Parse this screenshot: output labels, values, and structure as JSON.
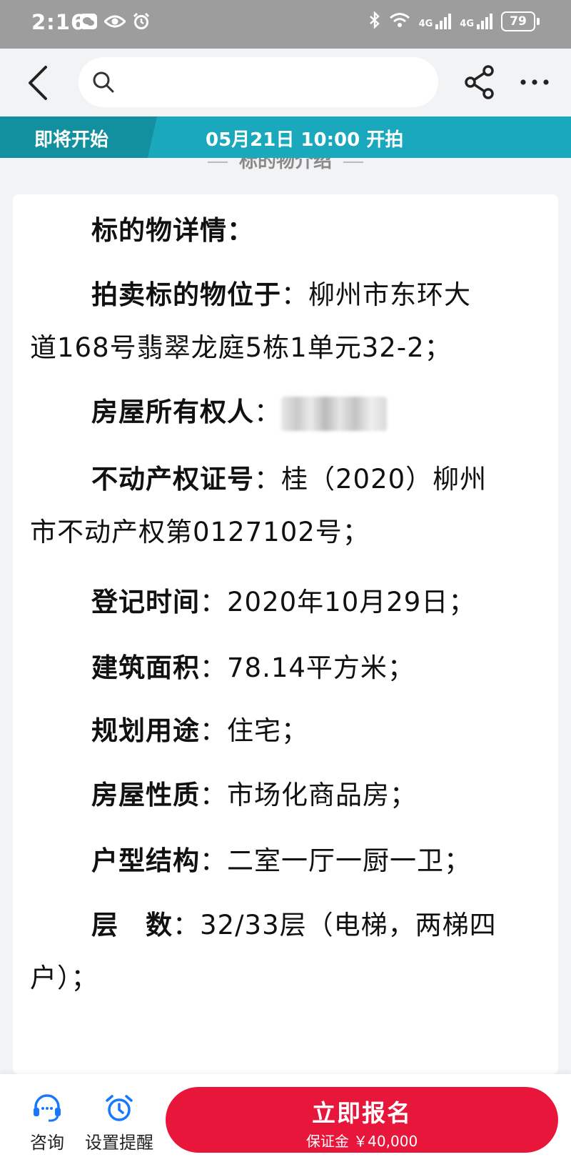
{
  "status_bar": {
    "time": "2:16",
    "net1": "4G",
    "net2": "4G",
    "battery": "79"
  },
  "nav": {
    "search_placeholder": ""
  },
  "banner": {
    "status": "即将开始",
    "time_text": "05月21日 10:00 开拍"
  },
  "section_peek": "标的物介绍",
  "details": {
    "title": "标的物详情：",
    "location_key": "拍卖标的物位于",
    "location_val_1": "：柳州市东环大",
    "location_val_2": "道168号翡翠龙庭5栋1单元32-2；",
    "owner_key": "房屋所有权人",
    "owner_sep": "：",
    "cert_key": "不动产权证号",
    "cert_val_1": "：桂（2020）柳州",
    "cert_val_2": "市不动产权第0127102号；",
    "reg_key": "登记时间",
    "reg_val": "：2020年10月29日；",
    "area_key": "建筑面积",
    "area_val": "：78.14平方米；",
    "use_key": "规划用途",
    "use_val": "：住宅；",
    "nature_key": "房屋性质",
    "nature_val": "：市场化商品房；",
    "layout_key": "户型结构",
    "layout_val": "：二室一厅一厨一卫；",
    "floor_key": "层　数",
    "floor_val_1": "：32/33层（电梯，两梯四",
    "floor_val_2": "户）；"
  },
  "bottom": {
    "consult_label": "咨询",
    "remind_label": "设置提醒",
    "signup_title": "立即报名",
    "signup_deposit": "保证金 ￥40,000"
  },
  "colors": {
    "banner": "#1aa8bd",
    "banner_dark": "#13909f",
    "cta": "#e7163a",
    "icon_blue": "#1677ff"
  }
}
